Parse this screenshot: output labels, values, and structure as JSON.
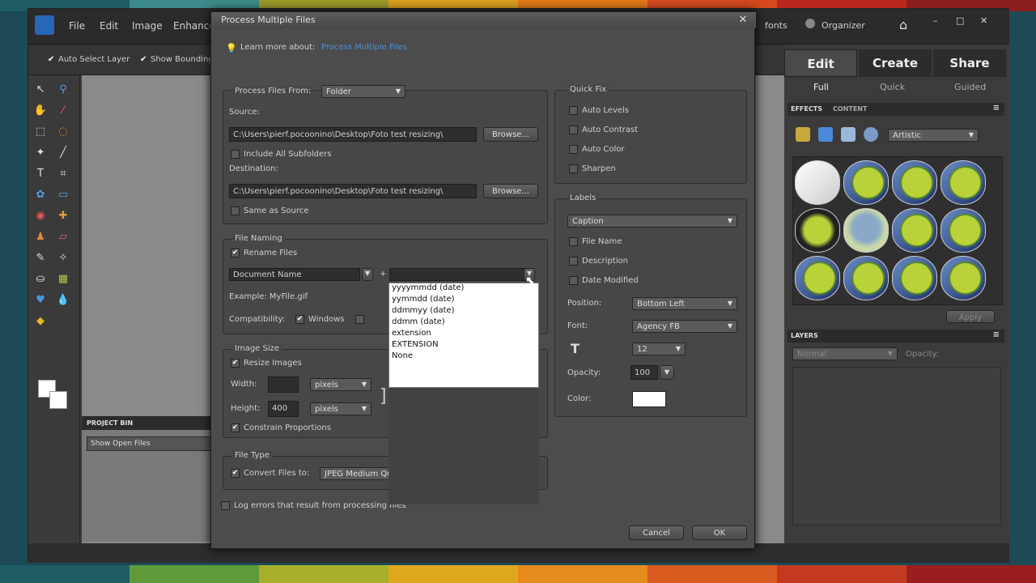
{
  "app": {
    "menus": [
      "File",
      "Edit",
      "Image",
      "Enhance"
    ],
    "right_menu": {
      "fonts": "fonts",
      "organizer": "Organizer"
    },
    "window_controls": [
      "–",
      "□",
      "✕"
    ],
    "options": {
      "auto_select": "Auto Select Layer",
      "show_bounding": "Show Bounding"
    }
  },
  "right_panel": {
    "tabs": [
      "Edit",
      "Create",
      "Share"
    ],
    "subtabs": [
      "Full",
      "Quick",
      "Guided"
    ],
    "effects_tabs": [
      "EFFECTS",
      "CONTENT"
    ],
    "effects_filter": "Artistic",
    "apply_label": "Apply",
    "layers_title": "LAYERS",
    "layers_blend": "Normal",
    "layers_opacity": "Opacity:"
  },
  "project_bin": {
    "title": "PROJECT BIN",
    "select": "Show Open Files"
  },
  "dialog": {
    "title": "Process Multiple Files",
    "learn_more": "Learn more about:",
    "learn_more_link": "Process Multiple Files",
    "process_files_from": "Process Files From:",
    "process_files_from_value": "Folder",
    "source_label": "Source:",
    "source_path": "C:\\Users\\pierf.pocoonino\\Desktop\\Foto test resizing\\",
    "browse": "Browse...",
    "include_subfolders": "Include All Subfolders",
    "destination_label": "Destination:",
    "destination_path": "C:\\Users\\pierf.pocoonino\\Desktop\\Foto test resizing\\",
    "same_as_source": "Same as Source",
    "file_naming_title": "File Naming",
    "rename_files": "Rename Files",
    "rename_part1": "Document Name",
    "plus": "+",
    "example": "Example: MyFile.gif",
    "compatibility": "Compatibility:",
    "windows": "Windows",
    "image_size_title": "Image Size",
    "resize_images": "Resize Images",
    "width_label": "Width:",
    "width_value": "",
    "height_label": "Height:",
    "height_value": "400",
    "unit": "pixels",
    "constrain": "Constrain Proportions",
    "file_type_title": "File Type",
    "convert_files": "Convert Files to:",
    "convert_value": "JPEG Medium Quality",
    "log_errors": "Log errors that result from processing files",
    "cancel": "Cancel",
    "ok": "OK",
    "quick_fix_title": "Quick Fix",
    "quick_fix": [
      "Auto Levels",
      "Auto Contrast",
      "Auto Color",
      "Sharpen"
    ],
    "labels_title": "Labels",
    "labels_select": "Caption",
    "labels_options": [
      "File Name",
      "Description",
      "Date Modified"
    ],
    "position_label": "Position:",
    "position_value": "Bottom Left",
    "font_label": "Font:",
    "font_value": "Agency FB",
    "font_size": "12",
    "opacity_label": "Opacity:",
    "opacity_value": "100",
    "color_label": "Color:",
    "dropdown": [
      "yyyymmdd (date)",
      "yymmdd (date)",
      "ddmmyy (date)",
      "ddmm (date)",
      "extension",
      "EXTENSION",
      "None"
    ]
  },
  "colors": {
    "accent": "#2a66b8",
    "link": "#4a8fd8",
    "panel": "#4c4c4c"
  }
}
